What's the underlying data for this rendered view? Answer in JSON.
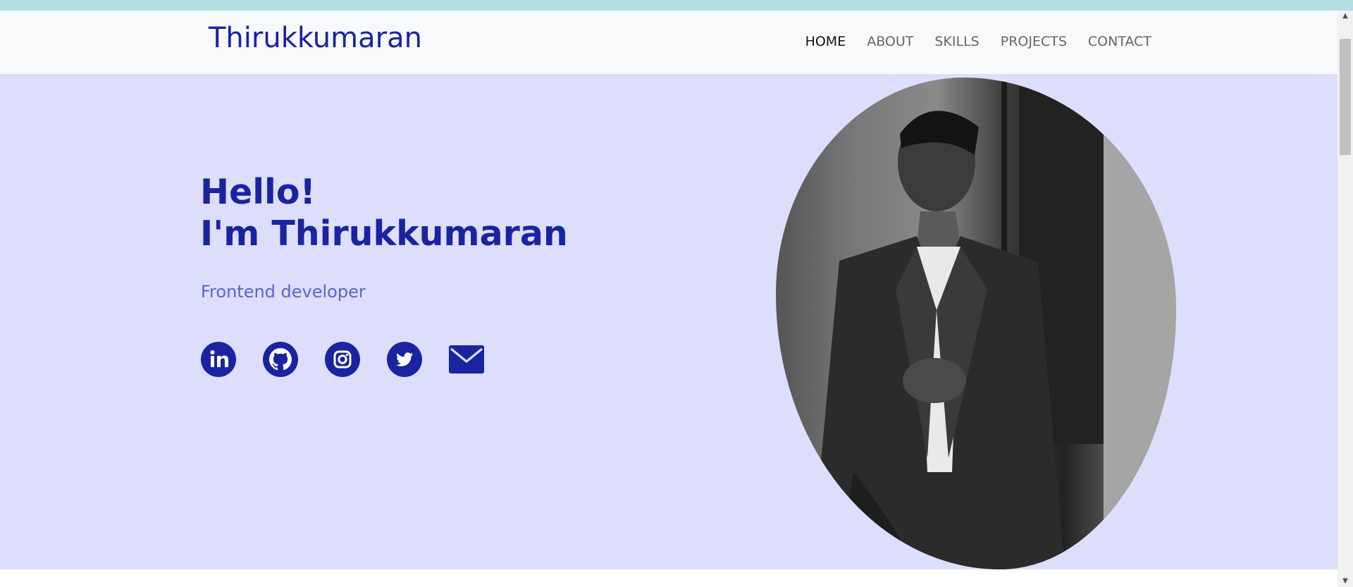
{
  "brand": "Thirukkumaran",
  "nav": [
    "HOME",
    "ABOUT",
    "SKILLS",
    "PROJECTS",
    "CONTACT"
  ],
  "hero": {
    "greeting": "Hello!",
    "name_line": "I'm Thirukkumaran",
    "subtitle": "Frontend developer"
  },
  "socials": [
    "linkedin-icon",
    "github-icon",
    "instagram-icon",
    "twitter-icon",
    "mail-icon"
  ],
  "colors": {
    "brand": "#1a23a0",
    "subtitle": "#5a63cf",
    "hero_bg": "#dcdefc",
    "nav_bg": "#f8f9fa",
    "top_strip": "#b5e0e3"
  },
  "scrollbar": {
    "up_arrow": "▲",
    "down_arrow": "▼"
  }
}
